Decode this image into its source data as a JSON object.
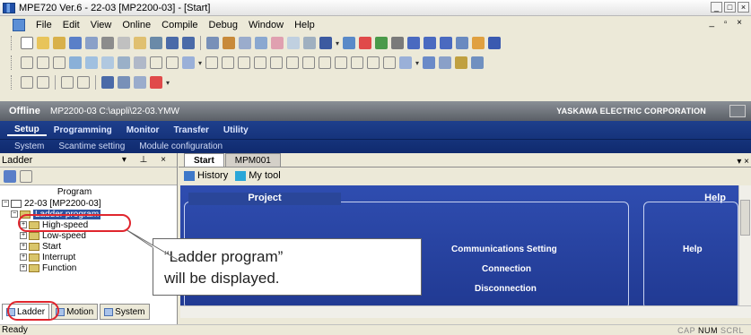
{
  "window": {
    "title": "MPE720 Ver.6 - 22-03 [MP2200-03] - [Start]"
  },
  "menu": [
    "File",
    "Edit",
    "View",
    "Online",
    "Compile",
    "Debug",
    "Window",
    "Help"
  ],
  "status_band": {
    "mode": "Offline",
    "path": "MP2200-03 C:\\appli\\22-03.YMW",
    "corp": "YASKAWA ELECTRIC CORPORATION"
  },
  "nav": {
    "tabs": [
      "Setup",
      "Programming",
      "Monitor",
      "Transfer",
      "Utility"
    ],
    "sub": [
      "System",
      "Scantime setting",
      "Module configuration"
    ]
  },
  "left_pane": {
    "title": "Ladder",
    "tree_header": "Program",
    "root": "22-03 [MP2200-03]",
    "selected": "Ladder program",
    "children": [
      "High-speed",
      "Low-speed",
      "Start",
      "Interrupt",
      "Function"
    ],
    "bottom_tabs": [
      "Ladder",
      "Motion",
      "System"
    ]
  },
  "doc": {
    "tabs": [
      "Start",
      "MPM001"
    ],
    "toolbar": [
      "History",
      "My tool"
    ],
    "project_header": "Project",
    "help_header": "Help",
    "links": [
      "Communications Setting",
      "Connection",
      "Disconnection"
    ],
    "help_link": "Help"
  },
  "callout": {
    "text": "“Ladder program”\nwill be displayed."
  },
  "statusbar": {
    "text": "Ready",
    "cap": "CAP",
    "num": "NUM",
    "scrl": "SCRL"
  },
  "colors": {
    "nav": "#1e3f8c",
    "canvas": "#2f4db0",
    "highlight": "#e0262e"
  }
}
